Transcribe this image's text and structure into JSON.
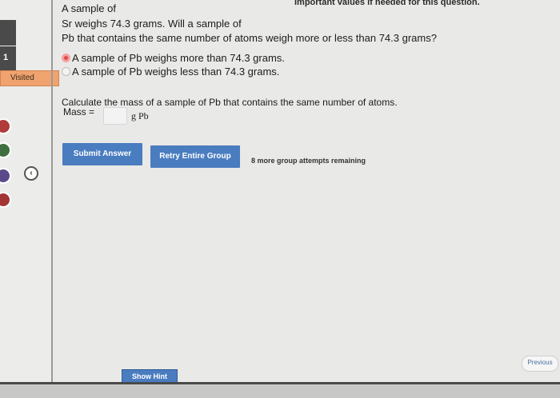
{
  "header": {
    "note": "Important values if needed for this question."
  },
  "question": {
    "line1": "A sample of",
    "line2": "Sr weighs 74.3 grams. Will a sample of",
    "line3": "Pb that contains the same number of atoms weigh more or less than 74.3 grams?"
  },
  "options": [
    {
      "label": "A sample of Pb weighs more than 74.3 grams.",
      "selected": true
    },
    {
      "label": "A sample of Pb weighs less than 74.3 grams.",
      "selected": false
    }
  ],
  "calc": {
    "prompt": "Calculate the mass of a sample of Pb that contains the same number of atoms.",
    "mass_label": "Mass =",
    "mass_value": "",
    "unit": "g Pb"
  },
  "buttons": {
    "submit": "Submit Answer",
    "retry": "Retry Entire Group",
    "attempts": "8 more group attempts remaining",
    "hint": "Show Hint",
    "previous": "Previous"
  },
  "sidebar": {
    "visited": "Visited",
    "number": "1",
    "collapse_icon": "chevron-left-icon"
  },
  "colors": {
    "accent": "#4a7cc0",
    "visited": "#f0a36e",
    "selected_radio": "#e04b4b"
  }
}
